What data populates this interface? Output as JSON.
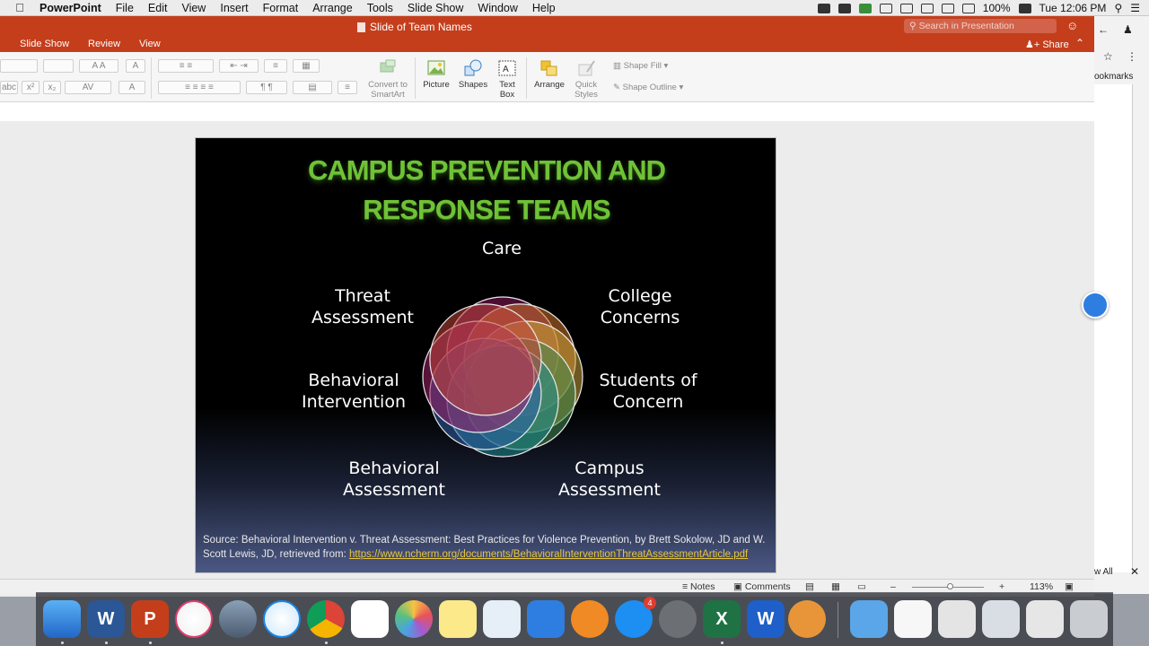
{
  "menubar": {
    "apple": "",
    "app_name": "PowerPoint",
    "menus": [
      "File",
      "Edit",
      "View",
      "Insert",
      "Format",
      "Arrange",
      "Tools",
      "Slide Show",
      "Window",
      "Help"
    ],
    "battery": "100%",
    "clock": "Tue 12:06 PM"
  },
  "window": {
    "document_title": "Slide of Team Names",
    "search_placeholder": "Search in Presentation",
    "tabs": [
      "Slide Show",
      "Review",
      "View"
    ],
    "share_label": "Share"
  },
  "ribbon": {
    "convert_label": "Convert to SmartArt",
    "picture_label": "Picture",
    "shapes_label": "Shapes",
    "textbox_label": "Text Box",
    "arrange_label": "Arrange",
    "quick_styles_label": "Quick Styles",
    "shape_fill_label": "Shape Fill",
    "shape_outline_label": "Shape Outline"
  },
  "slide": {
    "title_line1": "CAMPUS PREVENTION AND",
    "title_line2": "RESPONSE TEAMS",
    "labels": {
      "care": "Care",
      "threat_1": "Threat",
      "threat_2": "Assessment",
      "college_1": "College",
      "college_2": "Concerns",
      "bi_1": "Behavioral",
      "bi_2": "Intervention",
      "soc_1": "Students of",
      "soc_2": "Concern",
      "ba_1": "Behavioral",
      "ba_2": "Assessment",
      "ca_1": "Campus",
      "ca_2": "Assessment"
    },
    "source_prefix": "Source: Behavioral Intervention v. Threat Assessment: Best Practices for Violence Prevention, by Brett Sokolow, JD and W. Scott Lewis, JD, retrieved from: ",
    "source_link": "https://www.ncherm.org/documents/BehavioralInterventionThreatAssessmentArticle.pdf",
    "venn_colors": [
      "#8e1a5c",
      "#d3772c",
      "#c9a33a",
      "#3f8a4e",
      "#1d8a8e",
      "#2e5ea8",
      "#a0236a",
      "#c0463c"
    ]
  },
  "statusbar": {
    "notes_label": "Notes",
    "comments_label": "Comments",
    "zoom": "113%"
  },
  "browser": {
    "bookmarks_fragment": "ookmarks",
    "view_all_fragment": "w All"
  },
  "dock": {
    "appstore_badge": "4"
  }
}
